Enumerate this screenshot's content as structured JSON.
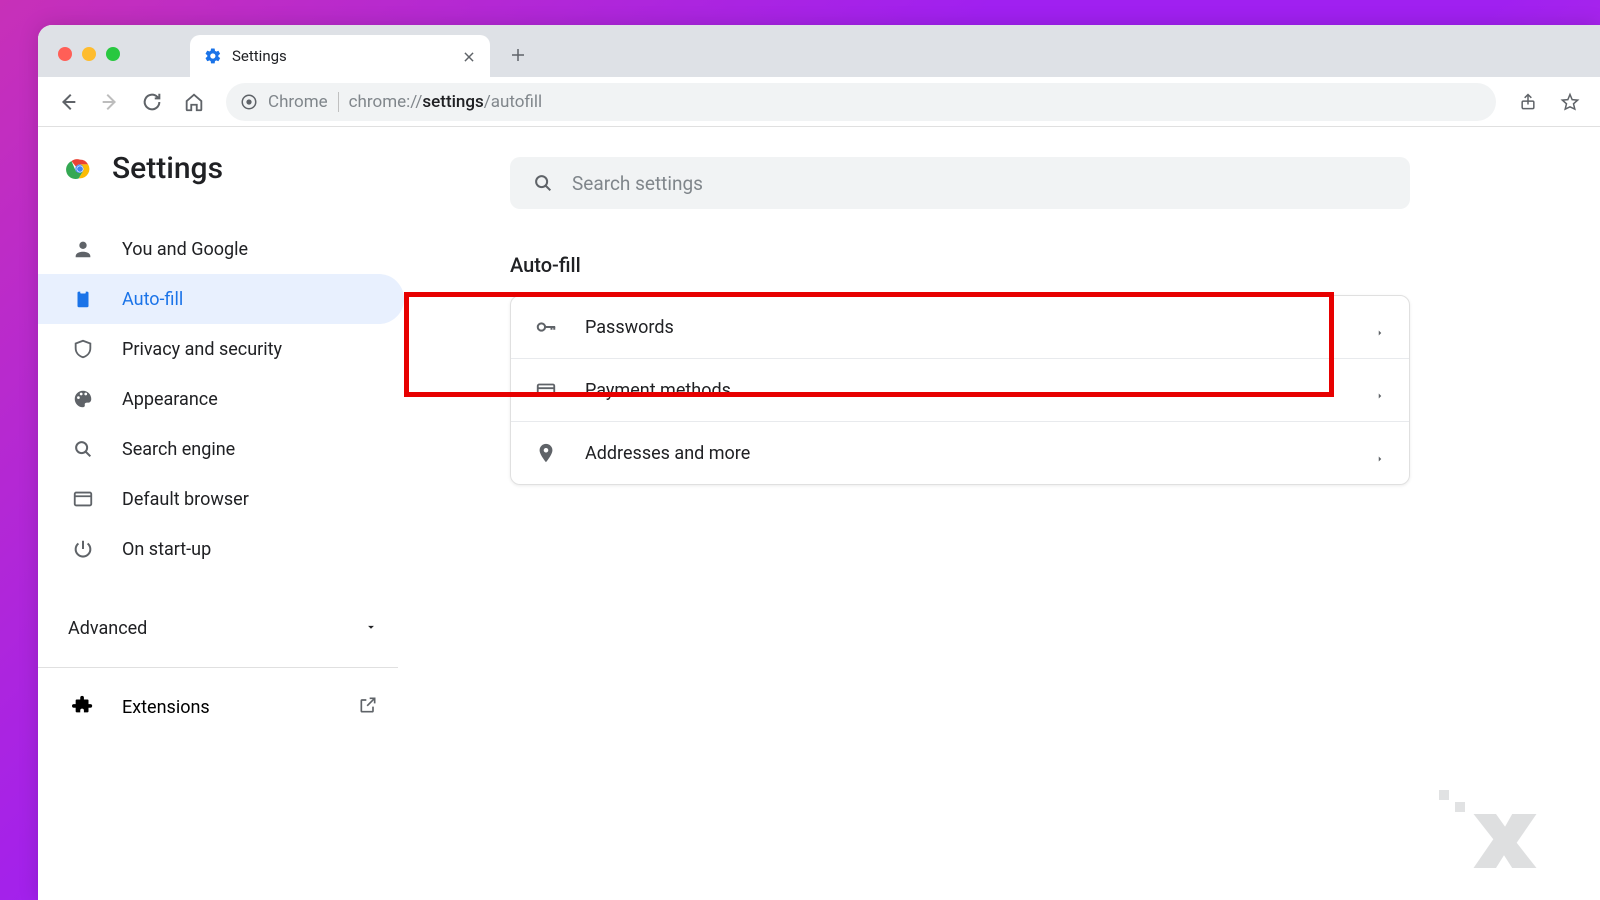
{
  "tab": {
    "title": "Settings"
  },
  "omnibox": {
    "origin_label": "Chrome",
    "host": "chrome://",
    "page": "settings",
    "path": "/autofill"
  },
  "header": {
    "title": "Settings"
  },
  "search": {
    "placeholder": "Search settings"
  },
  "sidebar": {
    "items": [
      {
        "label": "You and Google"
      },
      {
        "label": "Auto-fill"
      },
      {
        "label": "Privacy and security"
      },
      {
        "label": "Appearance"
      },
      {
        "label": "Search engine"
      },
      {
        "label": "Default browser"
      },
      {
        "label": "On start-up"
      }
    ],
    "advanced_label": "Advanced",
    "extensions_label": "Extensions"
  },
  "main": {
    "section_title": "Auto-fill",
    "rows": [
      {
        "label": "Passwords"
      },
      {
        "label": "Payment methods"
      },
      {
        "label": "Addresses and more"
      }
    ]
  }
}
